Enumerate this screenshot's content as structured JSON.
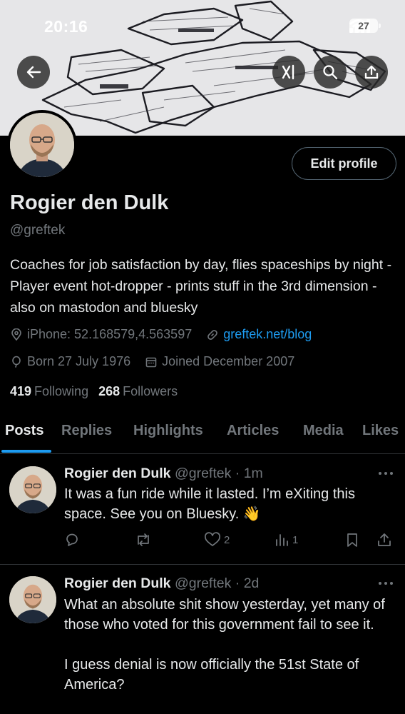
{
  "status_bar": {
    "time": "20:16",
    "battery": "27"
  },
  "profile": {
    "name": "Rogier den Dulk",
    "handle": "@greftek",
    "edit_label": "Edit profile",
    "bio": "Coaches for job satisfaction by day, flies spaceships by night - Player event hot-dropper - prints stuff in the 3rd dimension - also on mastodon and bluesky",
    "location": "iPhone: 52.168579,4.563597",
    "website": "greftek.net/blog",
    "born": "Born 27 July 1976",
    "joined": "Joined December 2007",
    "following_count": "419",
    "following_label": "Following",
    "followers_count": "268",
    "followers_label": "Followers"
  },
  "tabs": [
    "Posts",
    "Replies",
    "Highlights",
    "Articles",
    "Media",
    "Likes"
  ],
  "active_tab": "Posts",
  "colors": {
    "accent": "#1d9bf0",
    "muted": "#71767b",
    "background": "#000000",
    "border": "#2f3336"
  },
  "icons": {
    "header": [
      "back-arrow-icon",
      "grok-icon",
      "search-icon",
      "share-icon"
    ],
    "meta": [
      "location-pin-icon",
      "link-icon",
      "balloon-icon",
      "calendar-icon"
    ],
    "actions": [
      "reply-icon",
      "repost-icon",
      "like-icon",
      "views-icon",
      "bookmark-icon",
      "share-icon"
    ]
  },
  "posts": [
    {
      "name": "Rogier den Dulk",
      "handle": "@greftek",
      "time": "· 1m",
      "text": "It was a fun ride while it lasted. I’m eXiting this space. See you on Bluesky. 👋",
      "replies": "",
      "reposts": "",
      "likes": "2",
      "views": "1"
    },
    {
      "name": "Rogier den Dulk",
      "handle": "@greftek",
      "time": "· 2d",
      "text": "What an absolute shit show yesterday, yet many of those who voted for this government fail to see it.\n\nI guess denial is now officially the 51st State of America?"
    }
  ]
}
